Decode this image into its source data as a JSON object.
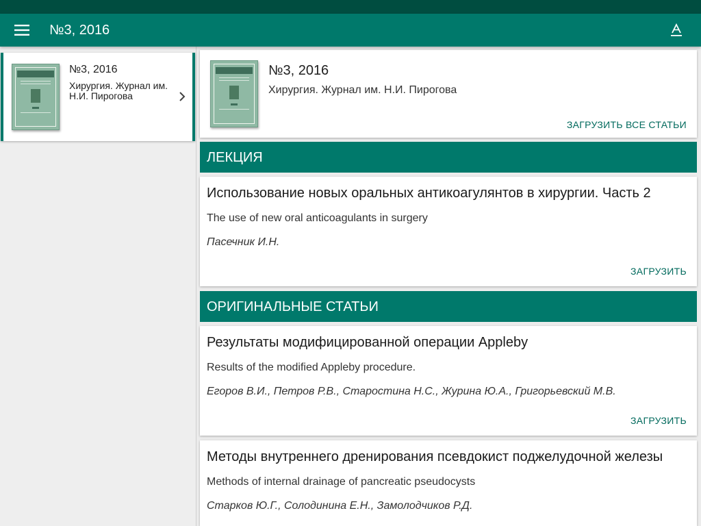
{
  "app_bar": {
    "title": "№3, 2016",
    "menu_icon": "menu-icon",
    "font_size_icon": "text-format-icon"
  },
  "colors": {
    "status_bar": "#004d40",
    "primary": "#00796b",
    "background": "#ececec",
    "card": "#ffffff"
  },
  "issue_list": [
    {
      "number": "№3, 2016",
      "journal": "Хирургия. Журнал им. Н.И. Пирогова",
      "selected": true
    }
  ],
  "issue_header": {
    "number": "№3, 2016",
    "journal": "Хирургия. Журнал им. Н.И. Пирогова",
    "download_all_label": "ЗАГРУЗИТЬ ВСЕ СТАТЬИ"
  },
  "sections": [
    {
      "name": "ЛЕКЦИЯ",
      "articles": [
        {
          "title": "Использование новых оральных антикоагулянтов в хирургии. Часть 2",
          "subtitle": "The use of new oral anticoagulants in surgery",
          "authors": "Пасечник И.Н.",
          "download_label": "ЗАГРУЗИТЬ"
        }
      ]
    },
    {
      "name": "ОРИГИНАЛЬНЫЕ СТАТЬИ",
      "articles": [
        {
          "title": "Результаты модифицированной операции Appleby",
          "subtitle": "Results of the modified Appleby procedure.",
          "authors": "Егоров В.И., Петров Р.В., Старостина Н.С., Журина Ю.А., Григорьевский М.В.",
          "download_label": "ЗАГРУЗИТЬ"
        },
        {
          "title": "Методы внутреннего дренирования псевдокист поджелудочной железы",
          "subtitle": "Methods of internal drainage of pancreatic pseudocysts",
          "authors": "Старков Ю.Г., Солодинина Е.Н., Замолодчиков Р.Д."
        }
      ]
    }
  ]
}
